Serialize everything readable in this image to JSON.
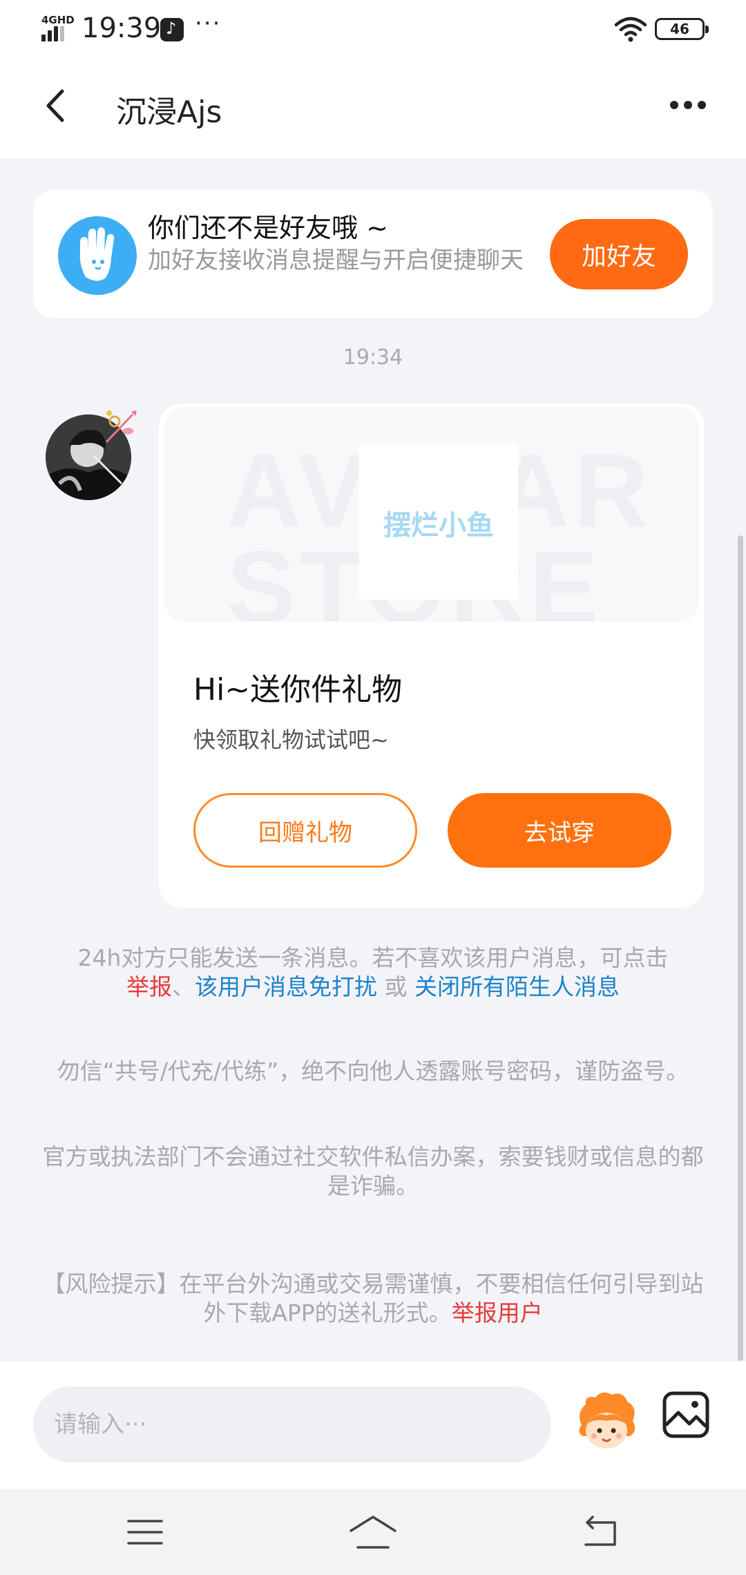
{
  "status_bar": {
    "network": "4GHD",
    "time": "19:39",
    "more": "···",
    "battery": "46"
  },
  "header": {
    "title": "沉浸Ajs"
  },
  "friend_banner": {
    "title": "你们还不是好友哦 ~",
    "subtitle": "加好友接收消息提醒与开启便捷聊天",
    "button_label": "加好友"
  },
  "chat": {
    "timestamp": "19:34",
    "gift_card": {
      "watermark": "AVATAR STORE",
      "preview_text": "摆烂小鱼",
      "title": "Hi~送你件礼物",
      "subtitle": "快领取礼物试试吧~",
      "return_button": "回赠礼物",
      "try_button": "去试穿"
    }
  },
  "notices": {
    "limit_text": "24h对方只能发送一条消息。若不喜欢该用户消息，可点击",
    "report": "举报",
    "sep1": "、",
    "mute_user": "该用户消息免打扰",
    "or": " 或 ",
    "close_strangers": "关闭所有陌生人消息",
    "account_warning": "勿信“共号/代充/代练”，绝不向他人透露账号密码，谨防盗号。",
    "fraud_warning": "官方或执法部门不会通过社交软件私信办案，索要钱财或信息的都是诈骗。",
    "risk_text": "【风险提示】在平台外沟通或交易需谨慎，不要相信任何引导到站外下载APP的送礼形式。",
    "report_user": "举报用户"
  },
  "input": {
    "placeholder": "请输入···"
  },
  "colors": {
    "accent": "#ff6a13",
    "link_blue": "#1d83c9",
    "link_red": "#e83a3a"
  }
}
